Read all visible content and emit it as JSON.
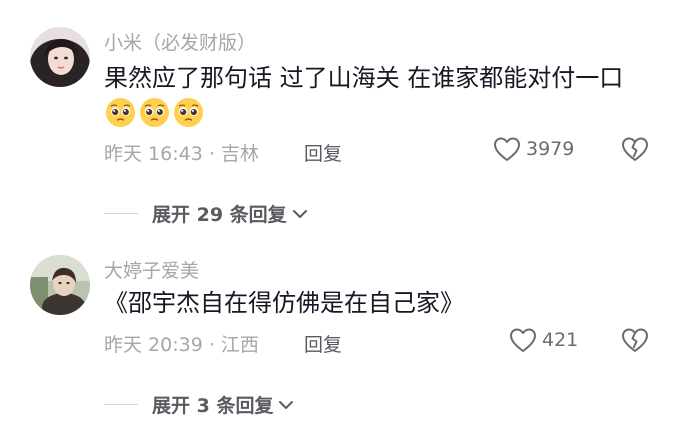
{
  "comments": [
    {
      "username": "小米（必发财版）",
      "text": "果然应了那句话 过了山海关 在谁家都能对付一口",
      "emojis": [
        "pleading-face-icon",
        "pleading-face-icon",
        "pleading-face-icon"
      ],
      "time_location": "昨天 16:43 · 吉林",
      "reply_label": "回复",
      "likes": "3979",
      "expand_label": "展开 29 条回复"
    },
    {
      "username": "大婷子爱美",
      "text": "《邵宇杰自在得仿佛是在自己家》",
      "emojis": [],
      "time_location": "昨天 20:39 · 江西",
      "reply_label": "回复",
      "likes": "421",
      "expand_label": "展开 3 条回复"
    }
  ],
  "colors": {
    "text_primary": "#161823",
    "text_secondary": "#a6a6ab",
    "icon_gray": "#6b6b70",
    "emoji_yellow": "#ffcf4d"
  }
}
